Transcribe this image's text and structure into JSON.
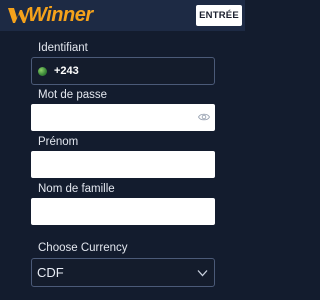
{
  "header": {
    "logo_text": "Winner",
    "login_button": "ENTRÉE",
    "brand_color": "#f5a21b"
  },
  "form": {
    "identifier_label": "Identifiant",
    "phone_prefix": "+243",
    "password_label": "Mot de passe",
    "password_value": "",
    "first_name_label": "Prénom",
    "first_name_value": "",
    "last_name_label": "Nom de famille",
    "last_name_value": "",
    "currency_label": "Choose Currency",
    "currency_value": "CDF"
  },
  "icons": {
    "flag": "flag-icon",
    "eye": "eye-icon",
    "chevron": "chevron-down-icon"
  }
}
